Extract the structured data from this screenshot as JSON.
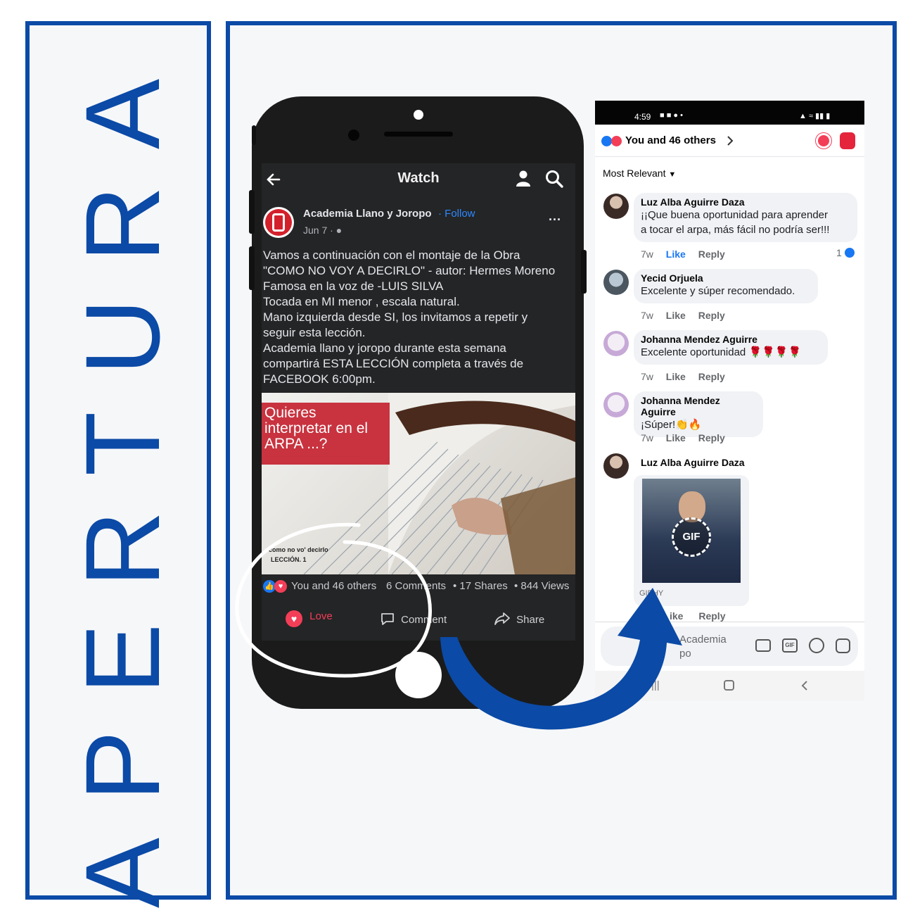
{
  "side_title": "APERTURA",
  "phone": {
    "topbar": {
      "title": "Watch"
    },
    "post": {
      "author": "Academia Llano y  Joropo",
      "follow": "Follow",
      "date": "Jun 7 ·",
      "more": "···",
      "text": "Vamos a continuación con el montaje de la Obra\n\"COMO NO VOY A DECIRLO\" - autor: Hermes Moreno\nFamosa en la voz de -LUIS SILVA\nTocada en MI menor , escala natural.\nMano izquierda desde SI, los invitamos a repetir y\nseguir esta lección.\nAcademia llano y joropo durante esta semana\ncompartirá ESTA LECCIÓN completa a través de\nFACEBOOK 6:00pm.",
      "video_banner": "Quieres\ninterpretar en el\nARPA ...?",
      "video_caption_1": "como no vo' decirlo",
      "video_caption_2": "LECCIÓN. 1"
    },
    "stats": {
      "reactions": "You and 46 others",
      "comments": "6 Comments",
      "shares": "• 17 Shares",
      "views": "• 844 Views"
    },
    "actions": {
      "love": "Love",
      "comment": "Comment",
      "share": "Share"
    }
  },
  "shot": {
    "status": {
      "time": "4:59"
    },
    "reactions_header": "You and 46 others",
    "sort": "Most Relevant",
    "comments": [
      {
        "name": "Luz Alba Aguirre Daza",
        "text": "¡¡Que buena oportunidad para aprender\na tocar el arpa, más fácil no podría ser!!!",
        "time": "7w",
        "like": "Like",
        "reply": "Reply",
        "reactions": "1"
      },
      {
        "name": "Yecid Orjuela",
        "text": "Excelente y súper recomendado.",
        "time": "7w",
        "like": "Like",
        "reply": "Reply"
      },
      {
        "name": "Johanna Mendez Aguirre",
        "text": "Excelente oportunidad",
        "emoji": "🌹🌹🌹🌹",
        "time": "7w",
        "like": "Like",
        "reply": "Reply"
      },
      {
        "name": "Johanna Mendez Aguirre",
        "text": "¡Súper!",
        "emoji": "👏🔥",
        "time": "7w",
        "like": "Like",
        "reply": "Reply"
      },
      {
        "name": "Luz Alba Aguirre Daza",
        "gif_label": "GIF",
        "gif_source": "GIPHY",
        "like": "ike",
        "reply": "Reply"
      }
    ],
    "input_placeholder": "Academia\npo"
  },
  "colors": {
    "brand_blue": "#0b4aa6",
    "love_red": "#f33e58",
    "fb_blue": "#1877f2"
  }
}
